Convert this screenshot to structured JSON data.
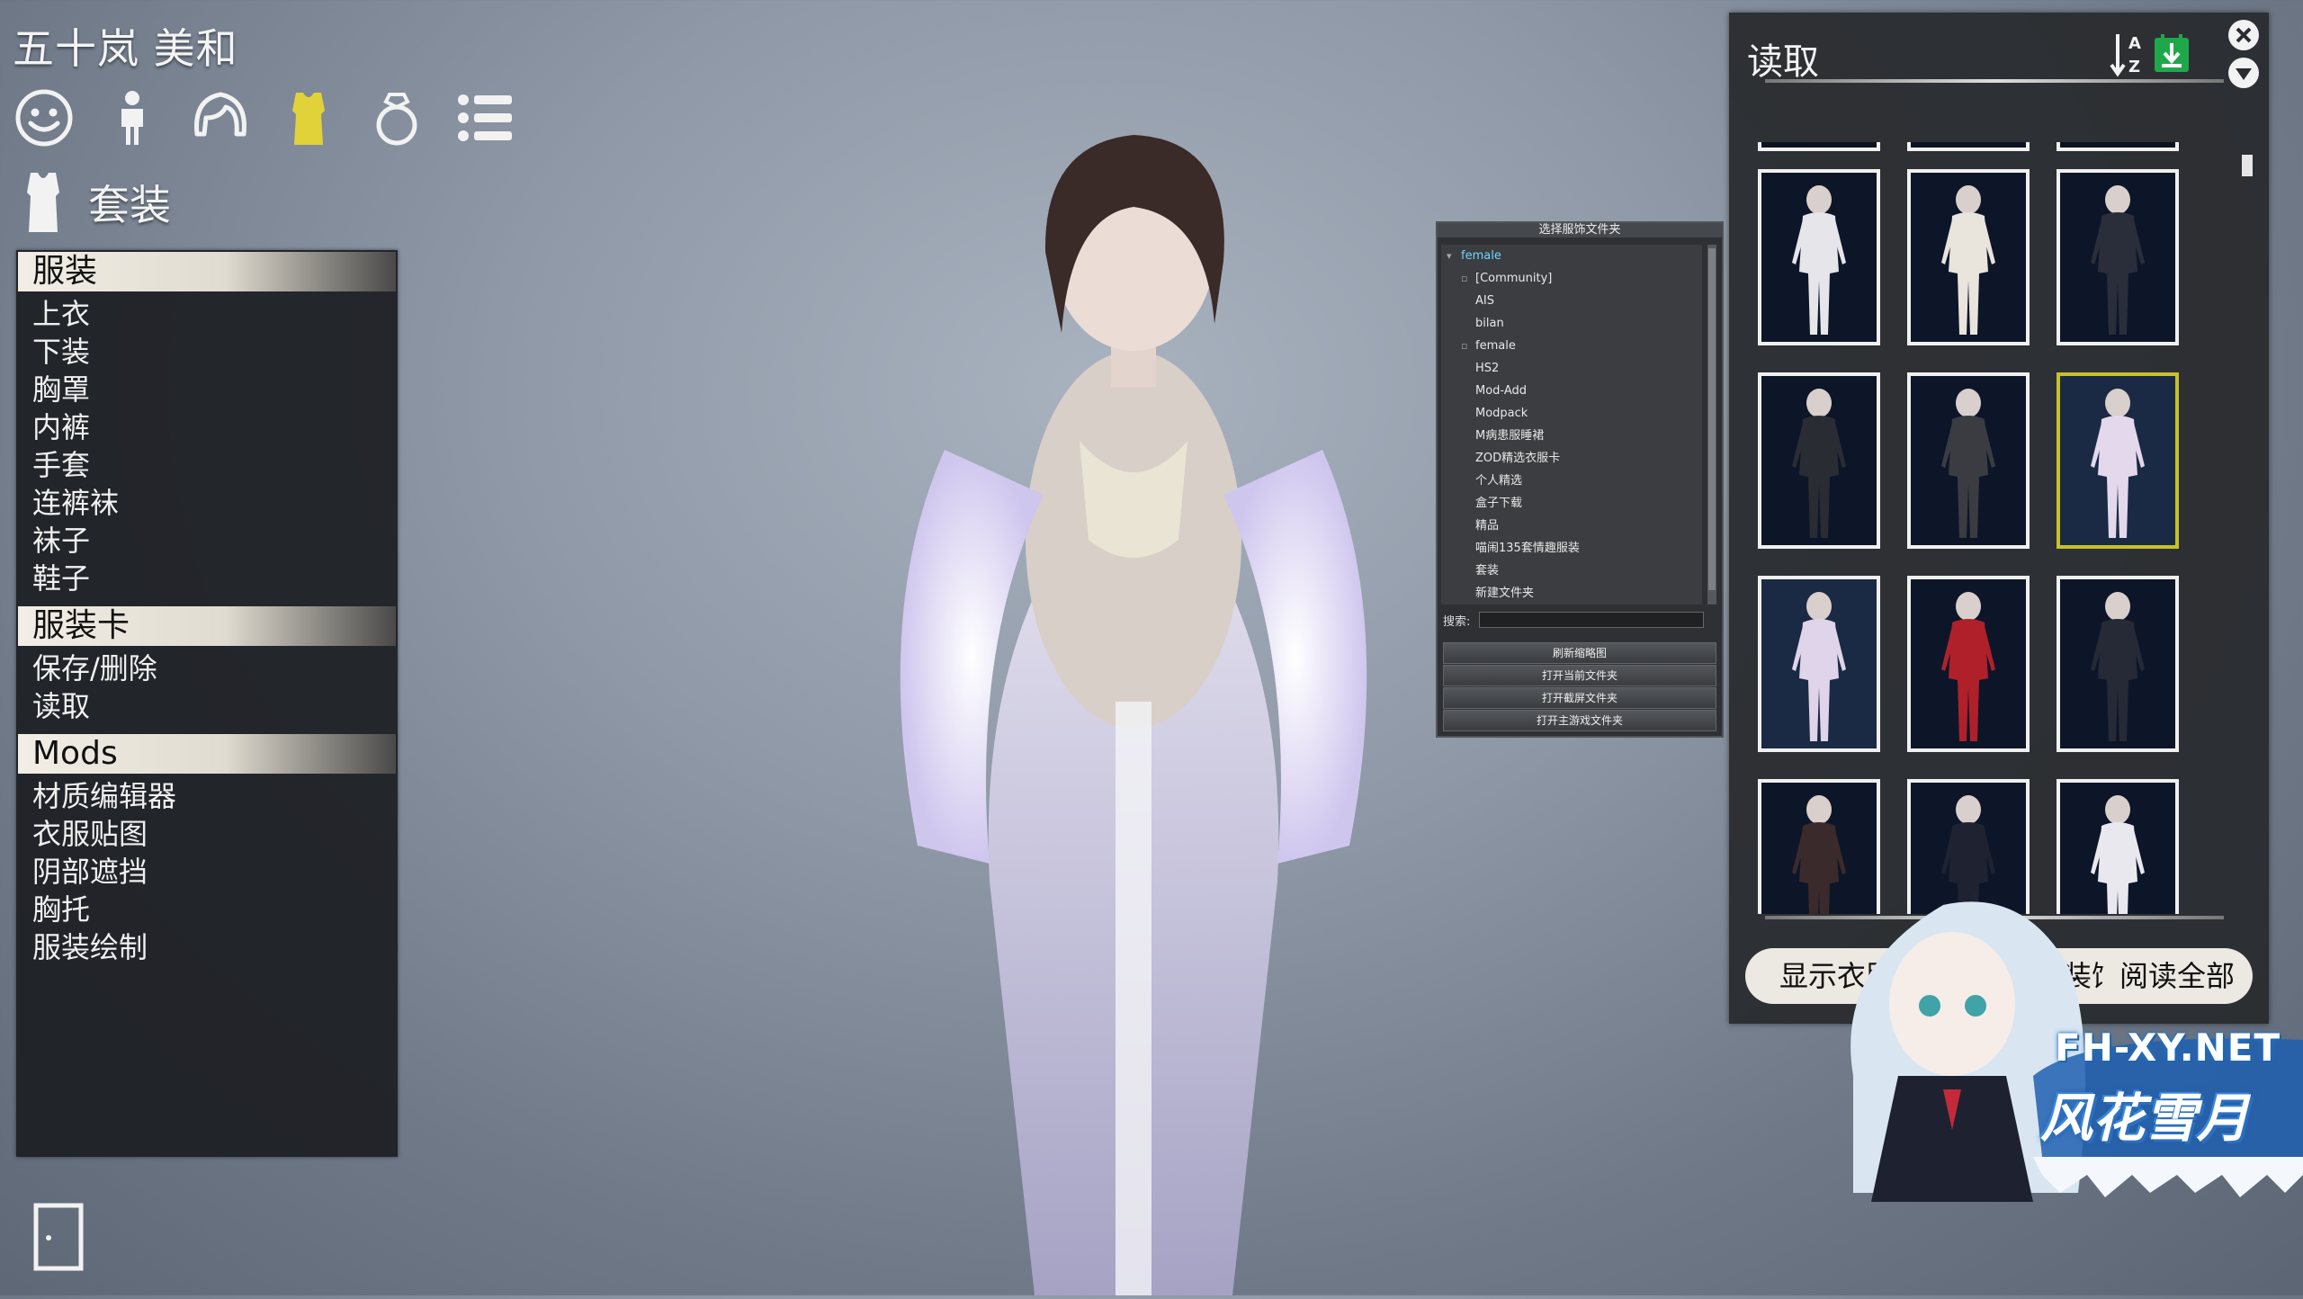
{
  "character": {
    "name": "五十岚 美和"
  },
  "category_icons": [
    {
      "icon": "face-icon",
      "active": false
    },
    {
      "icon": "body-icon",
      "active": false
    },
    {
      "icon": "hair-icon",
      "active": false
    },
    {
      "icon": "clothing-icon",
      "active": true
    },
    {
      "icon": "accessory-ring-icon",
      "active": false
    },
    {
      "icon": "list-icon",
      "active": false
    }
  ],
  "section": {
    "title": "套装",
    "icon": "shirt-icon"
  },
  "menu": {
    "groups": [
      {
        "title": "服装",
        "items": [
          "上衣",
          "下装",
          "胸罩",
          "内裤",
          "手套",
          "连裤袜",
          "袜子",
          "鞋子"
        ]
      },
      {
        "title": "服装卡",
        "items": [
          "保存/删除",
          "读取"
        ]
      },
      {
        "title": "Mods",
        "items": [
          "材质编辑器",
          "衣服贴图",
          "阴部遮挡",
          "胸托",
          "服装绘制"
        ]
      }
    ]
  },
  "folder_dialog": {
    "title": "选择服饰文件夹",
    "folders": [
      {
        "name": "female",
        "level": 0,
        "selected": true,
        "marker": "▾"
      },
      {
        "name": "[Community]",
        "level": 1,
        "selected": false,
        "marker": "▫"
      },
      {
        "name": "AIS",
        "level": 1,
        "selected": false,
        "marker": ""
      },
      {
        "name": "bilan",
        "level": 1,
        "selected": false,
        "marker": ""
      },
      {
        "name": "female",
        "level": 1,
        "selected": false,
        "marker": "▫"
      },
      {
        "name": "HS2",
        "level": 1,
        "selected": false,
        "marker": ""
      },
      {
        "name": "Mod-Add",
        "level": 1,
        "selected": false,
        "marker": ""
      },
      {
        "name": "Modpack",
        "level": 1,
        "selected": false,
        "marker": ""
      },
      {
        "name": "M病患服睡裙",
        "level": 1,
        "selected": false,
        "marker": ""
      },
      {
        "name": "ZOD精选衣服卡",
        "level": 1,
        "selected": false,
        "marker": ""
      },
      {
        "name": "个人精选",
        "level": 1,
        "selected": false,
        "marker": ""
      },
      {
        "name": "盒子下载",
        "level": 1,
        "selected": false,
        "marker": ""
      },
      {
        "name": "精品",
        "level": 1,
        "selected": false,
        "marker": ""
      },
      {
        "name": "喵闹135套情趣服装",
        "level": 1,
        "selected": false,
        "marker": ""
      },
      {
        "name": "套装",
        "level": 1,
        "selected": false,
        "marker": ""
      },
      {
        "name": "新建文件夹",
        "level": 1,
        "selected": false,
        "marker": ""
      }
    ],
    "search_label": "搜索:",
    "search_value": "",
    "buttons": [
      "刷新缩略图",
      "打开当前文件夹",
      "打开截屏文件夹",
      "打开主游戏文件夹"
    ]
  },
  "load_panel": {
    "title": "读取",
    "sort_icon": "sort-az-icon",
    "download_icon": "download-green-icon",
    "close_icon": "close-icon",
    "collapse_icon": "chevron-down-circle-icon",
    "thumbnails": [
      {
        "palette": "#e6e6ea",
        "bg": "#0d1628",
        "selected": false
      },
      {
        "palette": "#e9e4dc",
        "bg": "#0d1628",
        "selected": false
      },
      {
        "palette": "#2a2e3a",
        "bg": "#0d1628",
        "selected": false
      },
      {
        "palette": "#2a2c33",
        "bg": "#0d1628",
        "selected": false
      },
      {
        "palette": "#3a3c42",
        "bg": "#0d1628",
        "selected": false
      },
      {
        "palette": "#e4d8ec",
        "bg": "#1a2a44",
        "selected": true
      },
      {
        "palette": "#e0d4ea",
        "bg": "#1a2a44",
        "selected": false
      },
      {
        "palette": "#b0202a",
        "bg": "#0d1628",
        "selected": false
      },
      {
        "palette": "#262a36",
        "bg": "#0d1628",
        "selected": false
      },
      {
        "palette": "#3b2a2c",
        "bg": "#0d1628",
        "selected": false
      },
      {
        "palette": "#1f2230",
        "bg": "#0d1628",
        "selected": false
      },
      {
        "palette": "#e8e8ee",
        "bg": "#0d1628",
        "selected": false
      }
    ],
    "buttons": [
      {
        "label": "显示衣服",
        "name": "show-clothes-button"
      },
      {
        "label": "读取装饰",
        "name": "load-accessories-button"
      },
      {
        "label": "阅读全部",
        "name": "load-all-button"
      }
    ]
  },
  "watermark": {
    "url": "FH-XY.NET",
    "name": "风花雪月"
  }
}
